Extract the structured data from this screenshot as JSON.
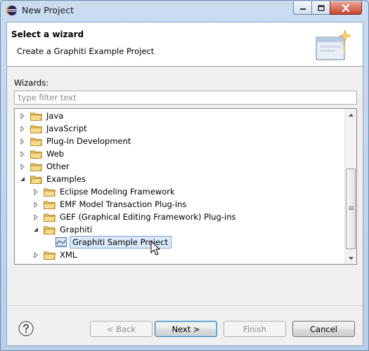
{
  "window": {
    "title": "New Project"
  },
  "header": {
    "title": "Select a wizard",
    "description": "Create a Graphiti Example Project"
  },
  "wizards": {
    "label": "Wizards:",
    "filter_placeholder": "type filter text"
  },
  "tree": {
    "items": [
      {
        "label": "Java",
        "level": 0,
        "expanded": false,
        "kind": "folder"
      },
      {
        "label": "JavaScript",
        "level": 0,
        "expanded": false,
        "kind": "folder"
      },
      {
        "label": "Plug-in Development",
        "level": 0,
        "expanded": false,
        "kind": "folder"
      },
      {
        "label": "Web",
        "level": 0,
        "expanded": false,
        "kind": "folder"
      },
      {
        "label": "Other",
        "level": 0,
        "expanded": false,
        "kind": "folder"
      },
      {
        "label": "Examples",
        "level": 0,
        "expanded": true,
        "kind": "folder"
      },
      {
        "label": "Eclipse Modeling Framework",
        "level": 1,
        "expanded": false,
        "kind": "folder"
      },
      {
        "label": "EMF Model Transaction Plug-ins",
        "level": 1,
        "expanded": false,
        "kind": "folder"
      },
      {
        "label": "GEF (Graphical Editing Framework) Plug-ins",
        "level": 1,
        "expanded": false,
        "kind": "folder"
      },
      {
        "label": "Graphiti",
        "level": 1,
        "expanded": true,
        "kind": "folder"
      },
      {
        "label": "Graphiti Sample Project",
        "level": 2,
        "expanded": null,
        "kind": "wizard",
        "selected": true
      },
      {
        "label": "XML",
        "level": 1,
        "expanded": false,
        "kind": "folder"
      }
    ]
  },
  "buttons": {
    "back": "< Back",
    "next": "Next >",
    "finish": "Finish",
    "cancel": "Cancel"
  },
  "colors": {
    "folder": "#e9c46a",
    "selection": "#dbe9fb",
    "selection_border": "#7da2ce",
    "default_button": "#3c7fb1"
  },
  "icons": {
    "help": "help-icon",
    "window": "eclipse-icon",
    "wizard_banner": "wizard-banner-icon"
  }
}
